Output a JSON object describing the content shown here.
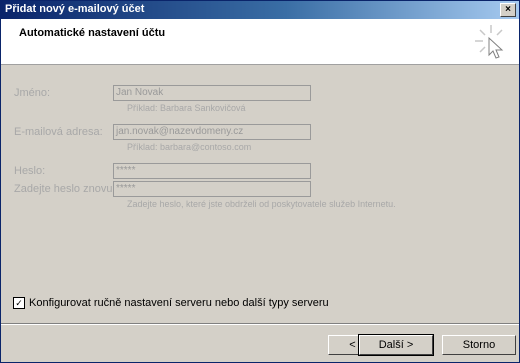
{
  "window": {
    "title": "Přidat nový e-mailový účet",
    "close_glyph": "×"
  },
  "header": {
    "title": "Automatické nastavení účtu",
    "icon": "cursor-click-icon"
  },
  "form": {
    "name": {
      "label": "Jméno:",
      "value": "Jan Novak",
      "hint": "Příklad: Barbara Sankovičová"
    },
    "email": {
      "label": "E-mailová adresa:",
      "value": "jan.novak@nazevdomeny.cz",
      "hint": "Příklad: barbara@contoso.com"
    },
    "password": {
      "label": "Heslo:",
      "value": "*****"
    },
    "password_confirm": {
      "label": "Zadejte heslo znovu:",
      "value": "*****",
      "hint": "Zadejte heslo, které jste obdrželi od poskytovatele služeb Internetu."
    }
  },
  "manual_config": {
    "label": "Konfigurovat ručně nastavení serveru nebo další typy serveru",
    "checked": true,
    "check_glyph": "✓"
  },
  "buttons": {
    "back": "< Zpět",
    "next": "Další >",
    "cancel": "Storno"
  }
}
